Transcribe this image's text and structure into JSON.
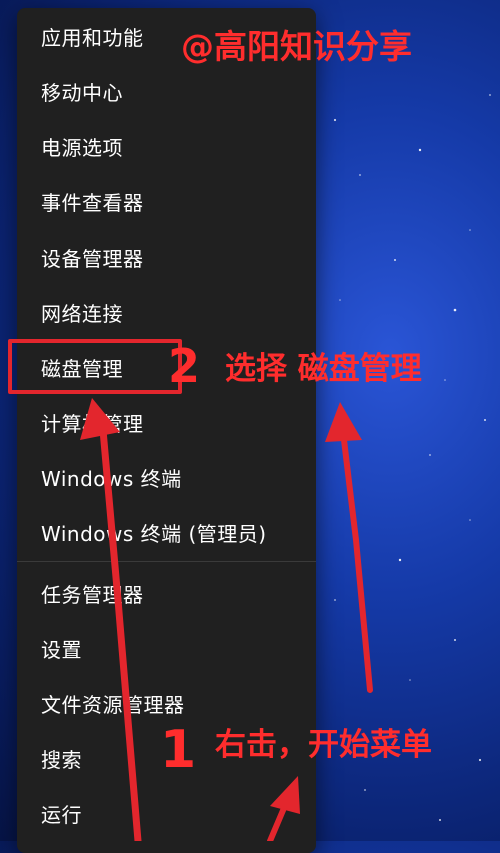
{
  "watermark": "@高阳知识分享",
  "menu": {
    "items": [
      {
        "label": "应用和功能"
      },
      {
        "label": "移动中心"
      },
      {
        "label": "电源选项"
      },
      {
        "label": "事件查看器"
      },
      {
        "label": "设备管理器"
      },
      {
        "label": "网络连接"
      },
      {
        "label": "磁盘管理"
      },
      {
        "label": "计算机管理"
      },
      {
        "label": "Windows 终端"
      },
      {
        "label": "Windows 终端 (管理员)"
      },
      {
        "label": "任务管理器"
      },
      {
        "label": "设置"
      },
      {
        "label": "文件资源管理器"
      },
      {
        "label": "搜索"
      },
      {
        "label": "运行"
      }
    ],
    "highlighted_item": "磁盘管理"
  },
  "annotations": {
    "step2_number": "2",
    "step2_text": "选择 磁盘管理",
    "step1_number": "1",
    "step1_text": "右击，开始菜单"
  },
  "colors": {
    "annotation": "#ff2d2d",
    "menu_background": "#202020",
    "wallpaper": "#0b2474"
  }
}
